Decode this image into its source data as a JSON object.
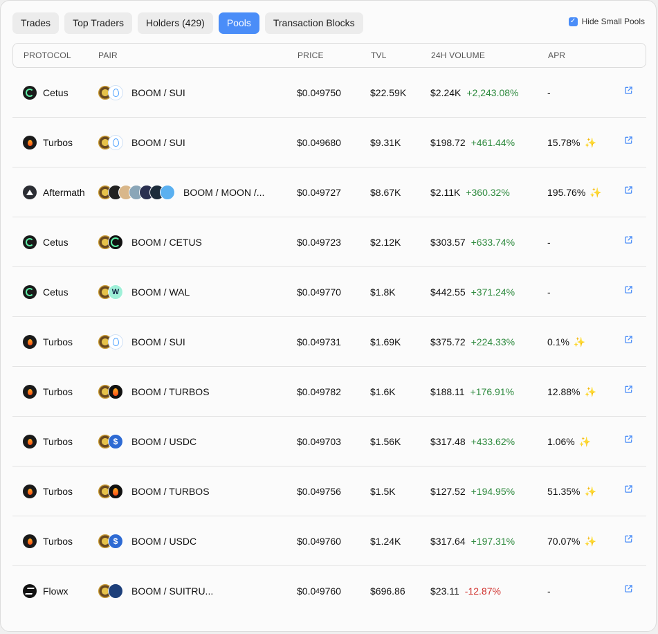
{
  "tabs": [
    {
      "label": "Trades",
      "active": false
    },
    {
      "label": "Top Traders",
      "active": false
    },
    {
      "label": "Holders (429)",
      "active": false
    },
    {
      "label": "Pools",
      "active": true
    },
    {
      "label": "Transaction Blocks",
      "active": false
    }
  ],
  "hide_small_pools": {
    "label": "Hide Small Pools",
    "checked": true
  },
  "columns": {
    "protocol": "PROTOCOL",
    "pair": "PAIR",
    "price": "PRICE",
    "tvl": "TVL",
    "volume": "24H VOLUME",
    "apr": "APR"
  },
  "colors": {
    "accent": "#4a8df8",
    "positive": "#2e8a3e",
    "negative": "#d0312d"
  },
  "rows": [
    {
      "protocol": "Cetus",
      "protocol_icon": "cetus",
      "tokens": [
        "boom",
        "sui"
      ],
      "pair": "BOOM / SUI",
      "price_prefix": "$0.0",
      "price_zeros": "4",
      "price_digits": "9750",
      "tvl": "$22.59K",
      "volume": "$2.24K",
      "change": "+2,243.08%",
      "change_dir": "pos",
      "apr": "-",
      "apr_sparkle": false
    },
    {
      "protocol": "Turbos",
      "protocol_icon": "turbos",
      "tokens": [
        "boom",
        "sui"
      ],
      "pair": "BOOM / SUI",
      "price_prefix": "$0.0",
      "price_zeros": "4",
      "price_digits": "9680",
      "tvl": "$9.31K",
      "volume": "$198.72",
      "change": "+461.44%",
      "change_dir": "pos",
      "apr": "15.78%",
      "apr_sparkle": true
    },
    {
      "protocol": "Aftermath",
      "protocol_icon": "aftermath",
      "tokens": [
        "boom",
        "moon",
        "t3",
        "t4",
        "t5",
        "t6",
        "t7"
      ],
      "pair": "BOOM / MOON /...",
      "price_prefix": "$0.0",
      "price_zeros": "4",
      "price_digits": "9727",
      "tvl": "$8.67K",
      "volume": "$2.11K",
      "change": "+360.32%",
      "change_dir": "pos",
      "apr": "195.76%",
      "apr_sparkle": true
    },
    {
      "protocol": "Cetus",
      "protocol_icon": "cetus",
      "tokens": [
        "boom",
        "cetus"
      ],
      "pair": "BOOM / CETUS",
      "price_prefix": "$0.0",
      "price_zeros": "4",
      "price_digits": "9723",
      "tvl": "$2.12K",
      "volume": "$303.57",
      "change": "+633.74%",
      "change_dir": "pos",
      "apr": "-",
      "apr_sparkle": false
    },
    {
      "protocol": "Cetus",
      "protocol_icon": "cetus",
      "tokens": [
        "boom",
        "wal"
      ],
      "pair": "BOOM / WAL",
      "price_prefix": "$0.0",
      "price_zeros": "4",
      "price_digits": "9770",
      "tvl": "$1.8K",
      "volume": "$442.55",
      "change": "+371.24%",
      "change_dir": "pos",
      "apr": "-",
      "apr_sparkle": false
    },
    {
      "protocol": "Turbos",
      "protocol_icon": "turbos",
      "tokens": [
        "boom",
        "sui"
      ],
      "pair": "BOOM / SUI",
      "price_prefix": "$0.0",
      "price_zeros": "4",
      "price_digits": "9731",
      "tvl": "$1.69K",
      "volume": "$375.72",
      "change": "+224.33%",
      "change_dir": "pos",
      "apr": "0.1%",
      "apr_sparkle": true
    },
    {
      "protocol": "Turbos",
      "protocol_icon": "turbos",
      "tokens": [
        "boom",
        "turbos"
      ],
      "pair": "BOOM / TURBOS",
      "price_prefix": "$0.0",
      "price_zeros": "4",
      "price_digits": "9782",
      "tvl": "$1.6K",
      "volume": "$188.11",
      "change": "+176.91%",
      "change_dir": "pos",
      "apr": "12.88%",
      "apr_sparkle": true
    },
    {
      "protocol": "Turbos",
      "protocol_icon": "turbos",
      "tokens": [
        "boom",
        "usdc"
      ],
      "pair": "BOOM / USDC",
      "price_prefix": "$0.0",
      "price_zeros": "4",
      "price_digits": "9703",
      "tvl": "$1.56K",
      "volume": "$317.48",
      "change": "+433.62%",
      "change_dir": "pos",
      "apr": "1.06%",
      "apr_sparkle": true
    },
    {
      "protocol": "Turbos",
      "protocol_icon": "turbos",
      "tokens": [
        "boom",
        "turbos"
      ],
      "pair": "BOOM / TURBOS",
      "price_prefix": "$0.0",
      "price_zeros": "4",
      "price_digits": "9756",
      "tvl": "$1.5K",
      "volume": "$127.52",
      "change": "+194.95%",
      "change_dir": "pos",
      "apr": "51.35%",
      "apr_sparkle": true
    },
    {
      "protocol": "Turbos",
      "protocol_icon": "turbos",
      "tokens": [
        "boom",
        "usdc"
      ],
      "pair": "BOOM / USDC",
      "price_prefix": "$0.0",
      "price_zeros": "4",
      "price_digits": "9760",
      "tvl": "$1.24K",
      "volume": "$317.64",
      "change": "+197.31%",
      "change_dir": "pos",
      "apr": "70.07%",
      "apr_sparkle": true
    },
    {
      "protocol": "Flowx",
      "protocol_icon": "flowx",
      "tokens": [
        "boom",
        "suitrump"
      ],
      "pair": "BOOM / SUITRU...",
      "price_prefix": "$0.0",
      "price_zeros": "4",
      "price_digits": "9760",
      "tvl": "$696.86",
      "volume": "$23.11",
      "change": "-12.87%",
      "change_dir": "neg",
      "apr": "-",
      "apr_sparkle": false
    }
  ]
}
